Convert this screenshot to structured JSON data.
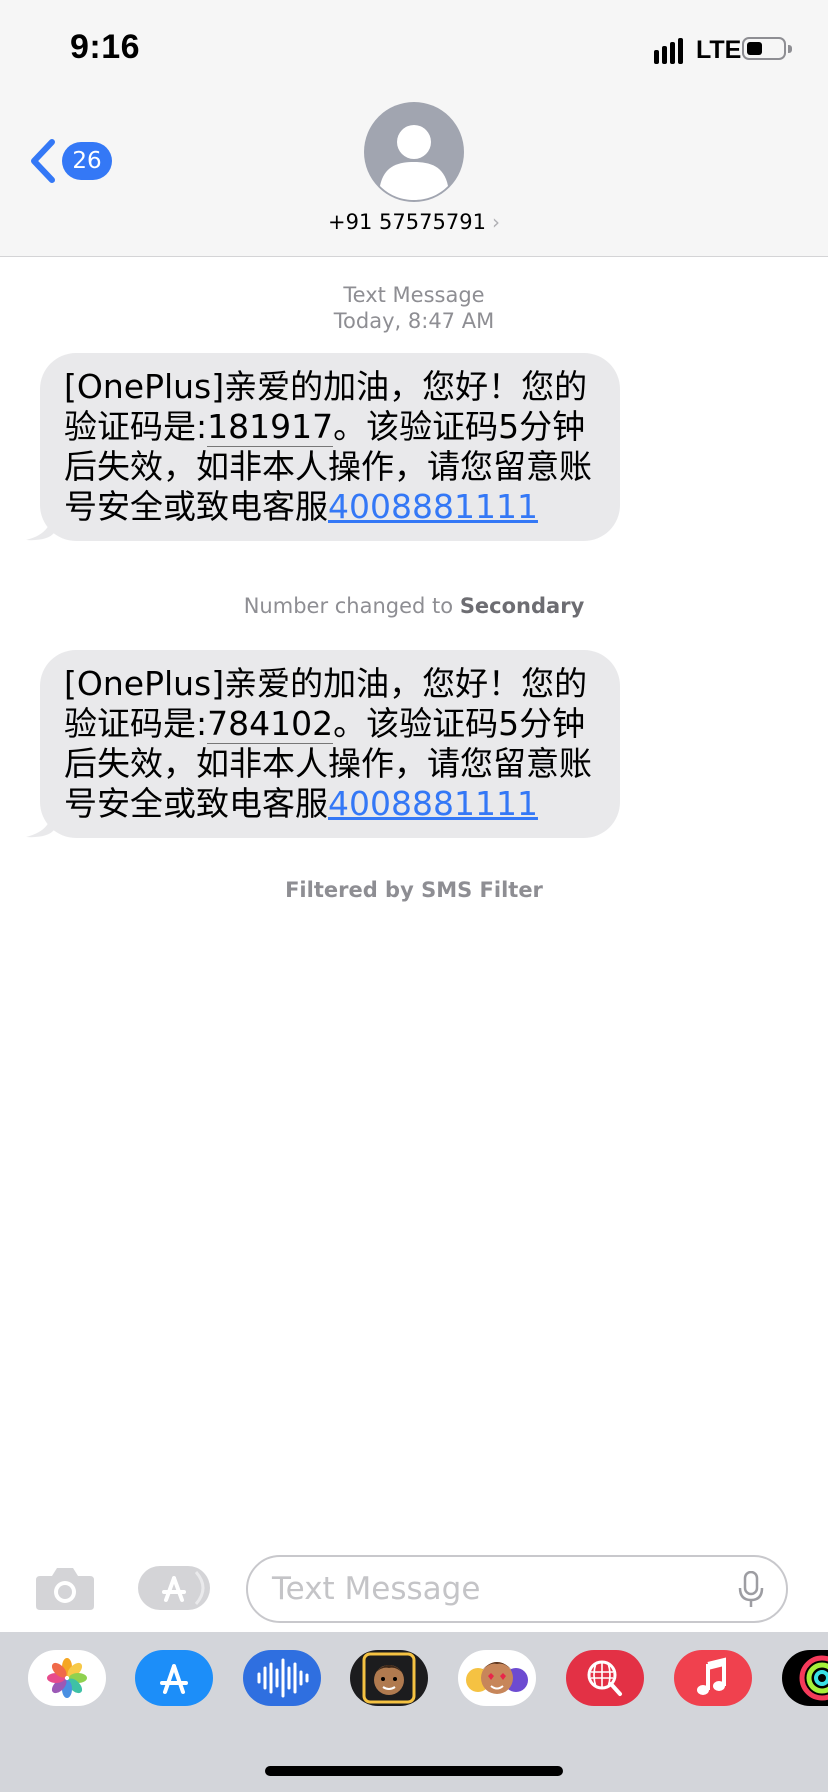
{
  "status_bar": {
    "time": "9:16",
    "network": "LTE"
  },
  "nav": {
    "back_count": "26",
    "contact": "+91 57575791"
  },
  "thread": {
    "header_label": "Text Message",
    "header_time": "Today, 8:47 AM",
    "messages": [
      {
        "pre": "[OnePlus]亲爱的加油，您好！您的验证码是:",
        "code": "181917",
        "post": "。该验证码5分钟后失效，如非本人操作，请您留意账号安全或致电客服",
        "phone": "4008881111"
      },
      {
        "pre": "[OnePlus]亲爱的加油，您好！您的验证码是:",
        "code": "784102",
        "post": "。该验证码5分钟后失效，如非本人操作，请您留意账号安全或致电客服",
        "phone": "4008881111"
      }
    ],
    "number_changed_prefix": "Number changed to",
    "number_changed_value": "Secondary",
    "filtered_notice": "Filtered by SMS Filter"
  },
  "composer": {
    "placeholder": "Text Message"
  },
  "app_strip": [
    "photos-app",
    "app-store-app",
    "audio-messages-app",
    "memoji-app",
    "memoji-stickers-app",
    "web-images-app",
    "music-app",
    "fitness-app"
  ],
  "colors": {
    "accent": "#3478f6",
    "bubble": "#e9e9eb",
    "meta_text": "#8e8e93",
    "strip_bg": "#d3d5da"
  }
}
